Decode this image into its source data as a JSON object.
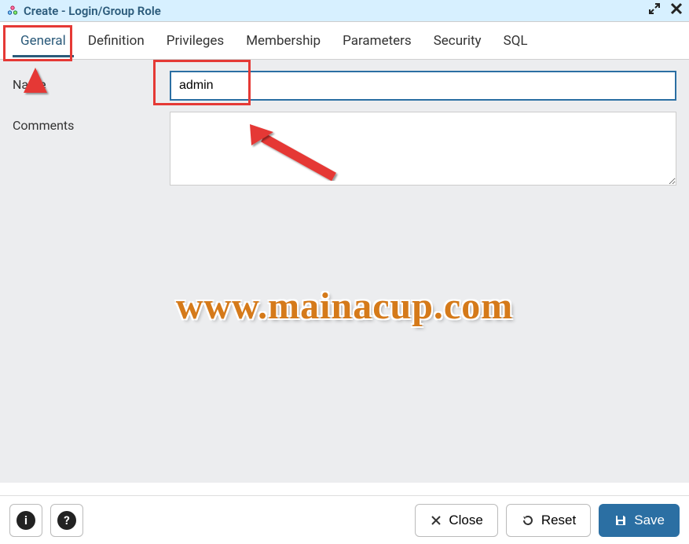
{
  "window": {
    "title": "Create - Login/Group Role"
  },
  "tabs": {
    "general": "General",
    "definition": "Definition",
    "privileges": "Privileges",
    "membership": "Membership",
    "parameters": "Parameters",
    "security": "Security",
    "sql": "SQL"
  },
  "form": {
    "name_label": "Name",
    "name_value": "admin",
    "comments_label": "Comments",
    "comments_value": ""
  },
  "footer": {
    "close_label": "Close",
    "reset_label": "Reset",
    "save_label": "Save"
  },
  "watermark": "www.mainacup.com"
}
